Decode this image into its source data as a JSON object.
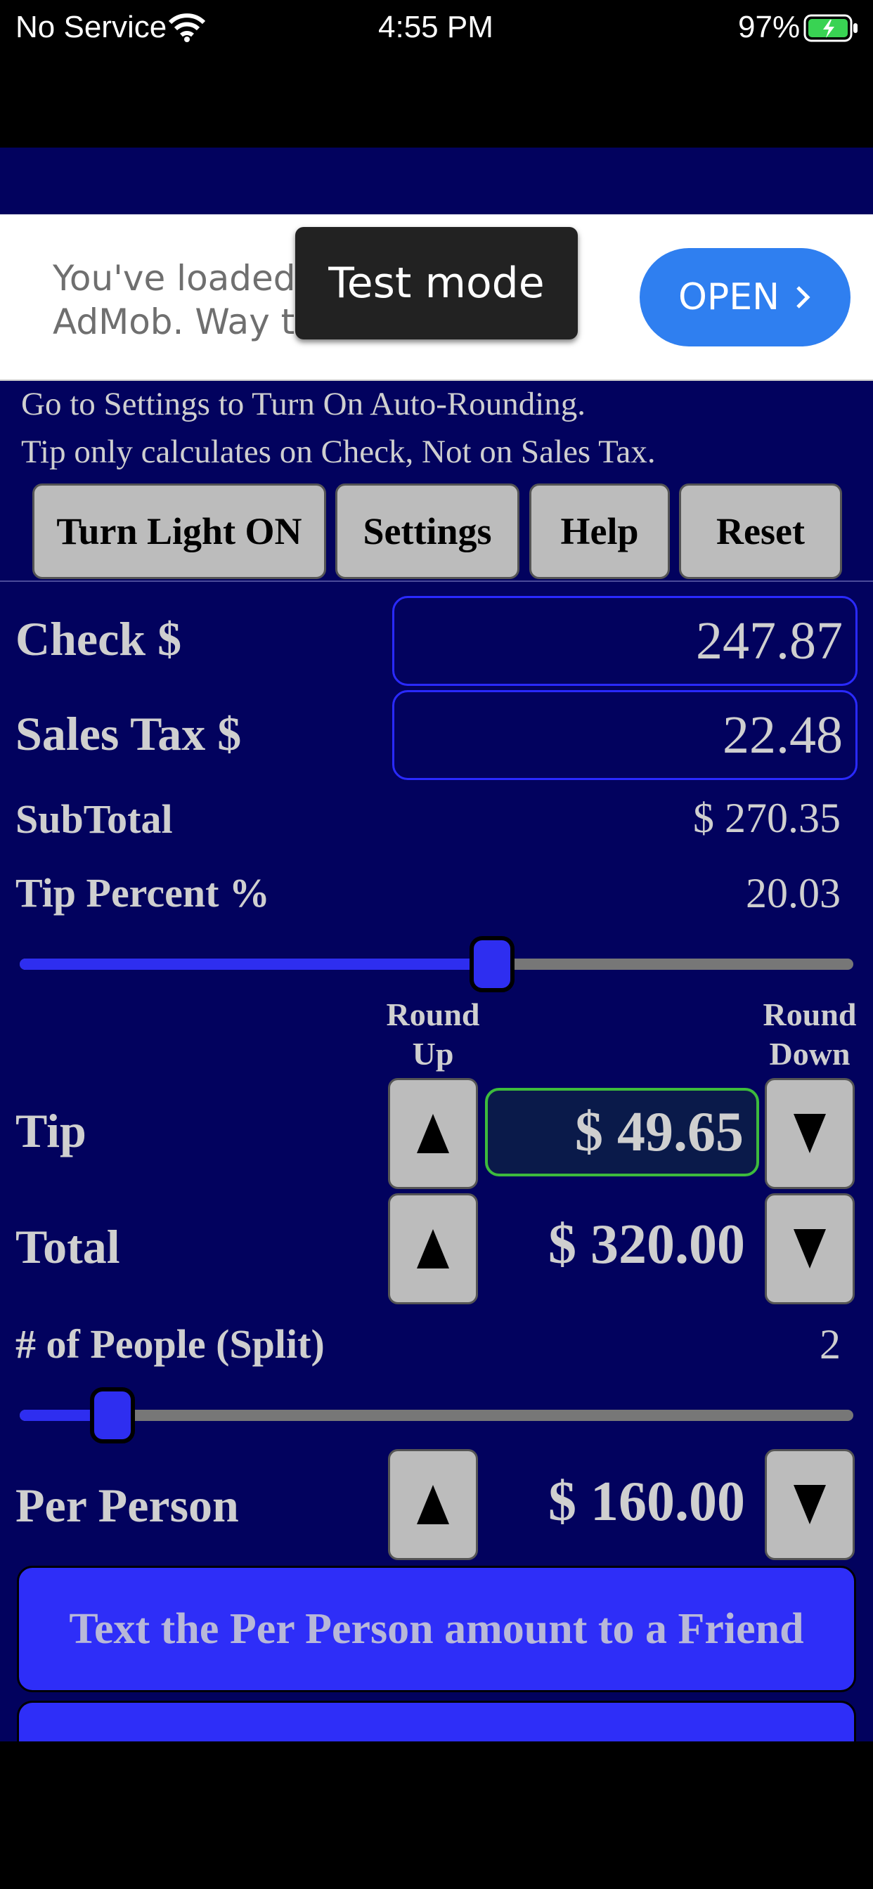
{
  "status_bar": {
    "carrier": "No Service",
    "time": "4:55 PM",
    "battery": "97%"
  },
  "ad": {
    "text_line1": "You've loaded a",
    "text_line2": "AdMob. Way to",
    "toast": "Test mode",
    "open_label": "OPEN",
    "open_color": "#2f7ff0"
  },
  "notes": {
    "line1": "Go to Settings to Turn On Auto-Rounding.",
    "line2": "Tip only calculates on Check, Not on Sales Tax."
  },
  "toolbar": {
    "light": "Turn Light ON",
    "settings": "Settings",
    "help": "Help",
    "reset": "Reset"
  },
  "check": {
    "label": "Check $",
    "value": "247.87"
  },
  "sales_tax": {
    "label": "Sales Tax $",
    "value": "22.48"
  },
  "subtotal": {
    "label": "SubTotal",
    "value": "$ 270.35"
  },
  "tip_percent": {
    "label": "Tip Percent %",
    "value": "20.03",
    "slider_fraction": 0.57
  },
  "rounding": {
    "up": "Round\nUp",
    "down": "Round\nDown"
  },
  "tip": {
    "label": "Tip",
    "value": "$ 49.65"
  },
  "total": {
    "label": "Total",
    "value": "$ 320.00"
  },
  "people": {
    "label": "# of People (Split)",
    "value": "2",
    "slider_fraction": 0.12
  },
  "per_person": {
    "label": "Per Person",
    "value": "$ 160.00"
  },
  "text_friend_label": "Text the Per Person amount to a Friend",
  "colors": {
    "app_bg": "#02025e",
    "accent_blue": "#2e2ef0",
    "tip_border": "#3dbb3d"
  }
}
